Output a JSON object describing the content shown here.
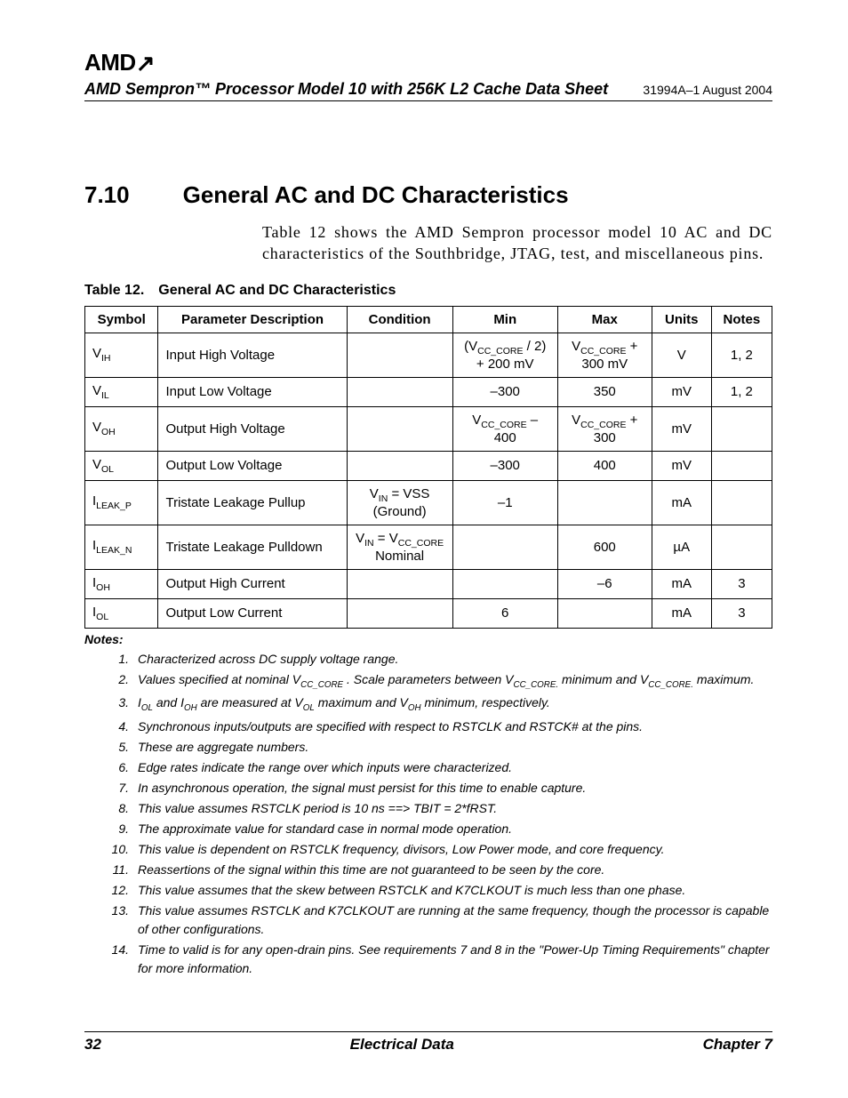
{
  "header": {
    "logo": "AMD",
    "doc_title": "AMD Sempron™ Processor Model 10 with 256K L2 Cache Data Sheet",
    "doc_id": "31994A–1 August 2004"
  },
  "section": {
    "number": "7.10",
    "title": "General AC and DC Characteristics",
    "intro": "Table 12 shows the AMD Sempron processor model 10 AC and DC characteristics of the Southbridge, JTAG, test, and miscellaneous pins."
  },
  "table": {
    "caption": "Table 12. General AC and DC Characteristics",
    "headers": {
      "symbol": "Symbol",
      "param": "Parameter Description",
      "cond": "Condition",
      "min": "Min",
      "max": "Max",
      "units": "Units",
      "notes": "Notes"
    },
    "rows": [
      {
        "sym_html": "V<span class='sub'>IH</span>",
        "param": "Input High Voltage",
        "cond_html": "",
        "min_html": "(V<span class='sub'>CC_CORE</span> / 2) + 200 mV",
        "max_html": "V<span class='sub'>CC_CORE</span> + 300 mV",
        "units": "V",
        "notes": "1, 2"
      },
      {
        "sym_html": "V<span class='sub'>IL</span>",
        "param": "Input Low Voltage",
        "cond_html": "",
        "min_html": "–300",
        "max_html": "350",
        "units": "mV",
        "notes": "1, 2"
      },
      {
        "sym_html": "V<span class='sub'>OH</span>",
        "param": "Output High Voltage",
        "cond_html": "",
        "min_html": "V<span class='sub'>CC_CORE</span> – 400",
        "max_html": "V<span class='sub'>CC_CORE</span> + 300",
        "units": "mV",
        "notes": ""
      },
      {
        "sym_html": "V<span class='sub'>OL</span>",
        "param": "Output Low Voltage",
        "cond_html": "",
        "min_html": "–300",
        "max_html": "400",
        "units": "mV",
        "notes": ""
      },
      {
        "sym_html": "I<span class='sub'>LEAK_P</span>",
        "param": "Tristate Leakage Pullup",
        "cond_html": "V<span class='sub'>IN</span> = VSS (Ground)",
        "min_html": "–1",
        "max_html": "",
        "units": "mA",
        "notes": ""
      },
      {
        "sym_html": "I<span class='sub'>LEAK_N</span>",
        "param": "Tristate Leakage Pulldown",
        "cond_html": "V<span class='sub'>IN</span> = V<span class='sub'>CC_CORE</span> Nominal",
        "min_html": "",
        "max_html": "600",
        "units": "µA",
        "notes": ""
      },
      {
        "sym_html": "I<span class='sub'>OH</span>",
        "param": "Output High Current",
        "cond_html": "",
        "min_html": "",
        "max_html": "–6",
        "units": "mA",
        "notes": "3"
      },
      {
        "sym_html": "I<span class='sub'>OL</span>",
        "param": "Output Low Current",
        "cond_html": "",
        "min_html": "6",
        "max_html": "",
        "units": "mA",
        "notes": "3"
      }
    ]
  },
  "notes": {
    "label": "Notes:",
    "items": [
      {
        "n": "1.",
        "text_html": "Characterized across DC supply voltage range."
      },
      {
        "n": "2.",
        "text_html": "Values specified at nominal V<span class='sub'>CC_CORE</span> . Scale parameters between V<span class='sub'>CC_CORE.</span> minimum and V<span class='sub'>CC_CORE.</span> maximum."
      },
      {
        "n": "3.",
        "text_html": "I<span class='sub'>OL</span> and I<span class='sub'>OH</span> are measured at V<span class='sub'>OL</span> maximum and V<span class='sub'>OH</span> minimum, respectively."
      },
      {
        "n": "4.",
        "text_html": "Synchronous inputs/outputs are specified with respect to RSTCLK and RSTCK# at the pins."
      },
      {
        "n": "5.",
        "text_html": "These are aggregate numbers."
      },
      {
        "n": "6.",
        "text_html": "Edge rates indicate the range over which inputs were characterized."
      },
      {
        "n": "7.",
        "text_html": "In asynchronous operation, the signal must persist for this time to enable capture."
      },
      {
        "n": "8.",
        "text_html": "This value assumes RSTCLK period is 10 ns ==&gt; TBIT = 2*fRST."
      },
      {
        "n": "9.",
        "text_html": "The approximate value for standard case in normal mode operation."
      },
      {
        "n": "10.",
        "text_html": "This value is dependent on RSTCLK frequency, divisors, Low Power mode, and core frequency."
      },
      {
        "n": "11.",
        "text_html": "Reassertions of the signal within this time are not guaranteed to be seen by the core."
      },
      {
        "n": "12.",
        "text_html": "This value assumes that the skew between RSTCLK and K7CLKOUT is much less than one phase."
      },
      {
        "n": "13.",
        "text_html": "This value assumes RSTCLK and K7CLKOUT are running at the same frequency, though the processor is capable of other configurations."
      },
      {
        "n": "14.",
        "text_html": "Time to valid is for any open-drain pins. See requirements 7 and 8  in the \"Power-Up Timing Requirements\" chapter for more information."
      }
    ]
  },
  "footer": {
    "page": "32",
    "center": "Electrical Data",
    "right": "Chapter 7"
  }
}
